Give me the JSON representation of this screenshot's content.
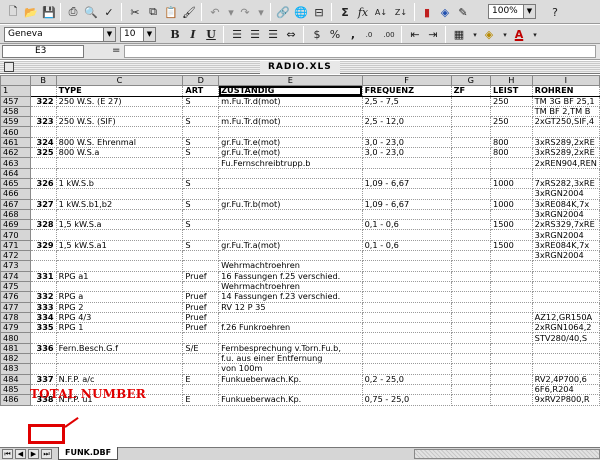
{
  "toolbar": {
    "zoom": "100%",
    "font_name": "Geneva",
    "font_size": "10",
    "bold": "B",
    "italic": "I",
    "underline": "U",
    "sum": "Σ",
    "fx": "fx",
    "currency": "$",
    "percent": "%",
    "comma": ",",
    "inc_dec": ".0",
    "dec_dec": ".00",
    "font_color": "A"
  },
  "formula_bar": {
    "cell_ref": "E3",
    "equals": "="
  },
  "window": {
    "title": "RADIO.XLS"
  },
  "columns": [
    "",
    "B",
    "C",
    "D",
    "E",
    "F",
    "G",
    "H",
    "I"
  ],
  "header_row": {
    "rownum": "1",
    "b": "",
    "c": "TYPE",
    "d": "ART",
    "e": "ZUSTANDIG",
    "f": "FREQUENZ",
    "g": "ZF",
    "h": "LEIST",
    "i": "ROHREN"
  },
  "rows": [
    {
      "n": "457",
      "b": "322",
      "c": "250 W.S. (E 27)",
      "d": "S",
      "e": "m.Fu.Tr.d(mot)",
      "f": "2,5 - 7,5",
      "g": "",
      "h": "250",
      "i": "TM 3G BF 25,1"
    },
    {
      "n": "458",
      "b": "",
      "c": "",
      "d": "",
      "e": "",
      "f": "",
      "g": "",
      "h": "",
      "i": "TM BF 2,TM B"
    },
    {
      "n": "459",
      "b": "323",
      "c": "250 W.S. (SIF)",
      "d": "S",
      "e": "m.Fu.Tr.d(mot)",
      "f": "2,5 - 12,0",
      "g": "",
      "h": "250",
      "i": "2xGT250,SIF,4"
    },
    {
      "n": "460",
      "b": "",
      "c": "",
      "d": "",
      "e": "",
      "f": "",
      "g": "",
      "h": "",
      "i": ""
    },
    {
      "n": "461",
      "b": "324",
      "c": "800 W.S. Ehrenmal",
      "d": "S",
      "e": "gr.Fu.Tr.e(mot)",
      "f": "3,0 - 23,0",
      "g": "",
      "h": "800",
      "i": "3xRS289,2xRE"
    },
    {
      "n": "462",
      "b": "325",
      "c": "800 W.S.a",
      "d": "S",
      "e": "gr.Fu.Tr.e(mot)",
      "f": "3,0 - 23,0",
      "g": "",
      "h": "800",
      "i": "3xRS289,2xRE"
    },
    {
      "n": "463",
      "b": "",
      "c": "",
      "d": "",
      "e": "Fu.Fernschreibtrupp.b",
      "f": "",
      "g": "",
      "h": "",
      "i": "2xREN904,REN"
    },
    {
      "n": "464",
      "b": "",
      "c": "",
      "d": "",
      "e": "",
      "f": "",
      "g": "",
      "h": "",
      "i": ""
    },
    {
      "n": "465",
      "b": "326",
      "c": "1 kW.S.b",
      "d": "S",
      "e": "",
      "f": "1,09 - 6,67",
      "g": "",
      "h": "1000",
      "i": "7xRS282,3xRE"
    },
    {
      "n": "466",
      "b": "",
      "c": "",
      "d": "",
      "e": "",
      "f": "",
      "g": "",
      "h": "",
      "i": "3xRGN2004"
    },
    {
      "n": "467",
      "b": "327",
      "c": "1 kW.S.b1,b2",
      "d": "S",
      "e": "gr.Fu.Tr.b(mot)",
      "f": "1,09 - 6,67",
      "g": "",
      "h": "1000",
      "i": "3xRE084K,7x"
    },
    {
      "n": "468",
      "b": "",
      "c": "",
      "d": "",
      "e": "",
      "f": "",
      "g": "",
      "h": "",
      "i": "3xRGN2004"
    },
    {
      "n": "469",
      "b": "328",
      "c": "1,5 kW.S.a",
      "d": "S",
      "e": "",
      "f": "0,1 - 0,6",
      "g": "",
      "h": "1500",
      "i": "2xRS329,7xRE"
    },
    {
      "n": "470",
      "b": "",
      "c": "",
      "d": "",
      "e": "",
      "f": "",
      "g": "",
      "h": "",
      "i": "3xRGN2004"
    },
    {
      "n": "471",
      "b": "329",
      "c": "1,5 kW.S.a1",
      "d": "S",
      "e": "gr.Fu.Tr.a(mot)",
      "f": "0,1 - 0,6",
      "g": "",
      "h": "1500",
      "i": "3xRE084K,7x"
    },
    {
      "n": "472",
      "b": "",
      "c": "",
      "d": "",
      "e": "",
      "f": "",
      "g": "",
      "h": "",
      "i": "3xRGN2004"
    },
    {
      "n": "473",
      "b": "",
      "c": "",
      "d": "",
      "e": "Wehrmachtroehren",
      "f": "",
      "g": "",
      "h": "",
      "i": ""
    },
    {
      "n": "474",
      "b": "331",
      "c": "RPG a1",
      "d": "Pruef",
      "e": "16 Fassungen f.25 verschied.",
      "f": "",
      "g": "",
      "h": "",
      "i": ""
    },
    {
      "n": "475",
      "b": "",
      "c": "",
      "d": "",
      "e": "Wehrmachtroehren",
      "f": "",
      "g": "",
      "h": "",
      "i": ""
    },
    {
      "n": "476",
      "b": "332",
      "c": "RPG a",
      "d": "Pruef",
      "e": "14 Fassungen f.23 verschied.",
      "f": "",
      "g": "",
      "h": "",
      "i": ""
    },
    {
      "n": "477",
      "b": "333",
      "c": "RPG 2",
      "d": "Pruef",
      "e": "RV 12 P 35",
      "f": "",
      "g": "",
      "h": "",
      "i": ""
    },
    {
      "n": "478",
      "b": "334",
      "c": "RPG 4/3",
      "d": "Pruef",
      "e": "",
      "f": "",
      "g": "",
      "h": "",
      "i": "AZ12,GR150A"
    },
    {
      "n": "479",
      "b": "335",
      "c": "RPG 1",
      "d": "Pruef",
      "e": "f.26 Funkroehren",
      "f": "",
      "g": "",
      "h": "",
      "i": "2xRGN1064,2"
    },
    {
      "n": "480",
      "b": "",
      "c": "",
      "d": "",
      "e": "",
      "f": "",
      "g": "",
      "h": "",
      "i": "STV280/40,S"
    },
    {
      "n": "481",
      "b": "336",
      "c": "Fern.Besch.G.f",
      "d": "S/E",
      "e": "Fernbesprechung v.Torn.Fu.b,",
      "f": "",
      "g": "",
      "h": "",
      "i": ""
    },
    {
      "n": "482",
      "b": "",
      "c": "",
      "d": "",
      "e": "f.u. aus einer Entfernung",
      "f": "",
      "g": "",
      "h": "",
      "i": ""
    },
    {
      "n": "483",
      "b": "",
      "c": "",
      "d": "",
      "e": "von 100m",
      "f": "",
      "g": "",
      "h": "",
      "i": ""
    },
    {
      "n": "484",
      "b": "337",
      "c": "N.F.P. a/c",
      "d": "E",
      "e": "Funkueberwach.Kp.",
      "f": "0,2 - 25,0",
      "g": "",
      "h": "",
      "i": "RV2,4P700,6"
    },
    {
      "n": "485",
      "b": "",
      "c": "",
      "d": "",
      "e": "",
      "f": "",
      "g": "",
      "h": "",
      "i": "6F6,R204"
    },
    {
      "n": "486",
      "b": "338",
      "c": "N.F.P. u1",
      "d": "E",
      "e": "Funkueberwach.Kp.",
      "f": "0,75 - 25,0",
      "g": "",
      "h": "",
      "i": "9xRV2P800,R"
    }
  ],
  "sheet_tab": "FUNK.DBF",
  "annotation": {
    "label": "TOTAL NUMBER",
    "color": "#e00000"
  }
}
